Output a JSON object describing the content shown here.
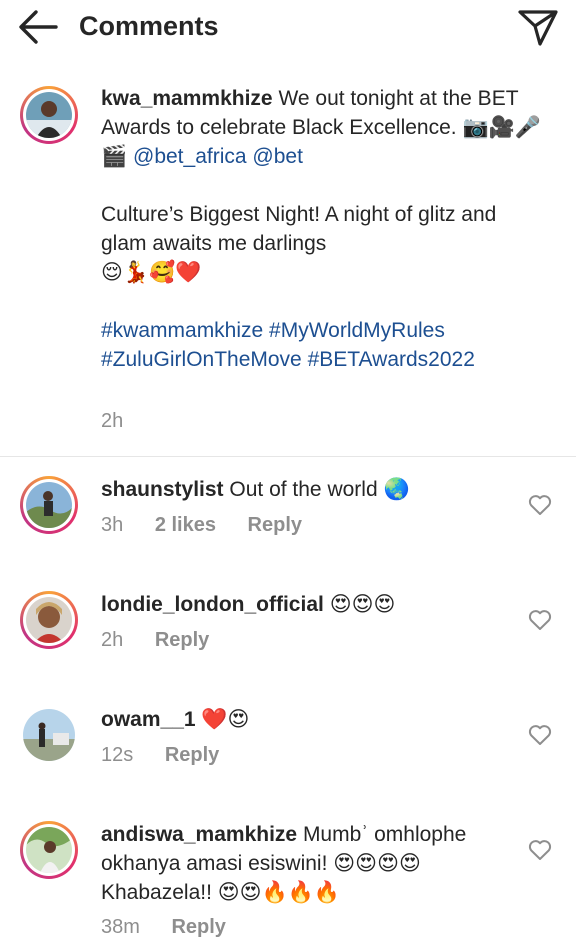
{
  "header": {
    "title": "Comments",
    "back_icon": "arrow-left-icon",
    "share_icon": "paper-plane-icon"
  },
  "caption": {
    "username": "kwa_mammkhize",
    "text_1": "We out tonight at the BET Awards to celebrate Black Excellence.",
    "emojis_1": "📷🎥🎤🎬",
    "mention_1": "@bet_africa",
    "mention_2": "@bet",
    "text_2": "Culture’s Biggest Night! A night of glitz and glam awaits me darlings",
    "emojis_2": "😌💃🥰❤️",
    "hashtags_line_1": "#kwammamkhize #MyWorldMyRules",
    "hashtags_line_2": "#ZuluGirlOnTheMove #BETAwards2022",
    "time": "2h"
  },
  "comments": [
    {
      "username": "shaunstylist",
      "text": "Out of the world",
      "emoji": "🌏",
      "time": "3h",
      "likes": "2 likes",
      "reply": "Reply"
    },
    {
      "username": "londie_london_official",
      "text": "",
      "emoji": "😍😍😍",
      "time": "2h",
      "likes": "",
      "reply": "Reply"
    },
    {
      "username": "owam__1",
      "text": "",
      "emoji": "❤️😍",
      "time": "12s",
      "likes": "",
      "reply": "Reply"
    },
    {
      "username": "andiswa_mamkhize",
      "text": "Mumbʾ omhlophe okhanya amasi esiswini!",
      "emoji": "😍😍😍😍",
      "text_2": "Khabazela!!",
      "emoji_2": "😍😍🔥🔥🔥",
      "time": "38m",
      "likes": "",
      "reply": "Reply"
    }
  ],
  "colors": {
    "text": "#262626",
    "secondary": "#8e8e8e",
    "link": "#1d4f91",
    "divider": "#e6e6e6"
  }
}
